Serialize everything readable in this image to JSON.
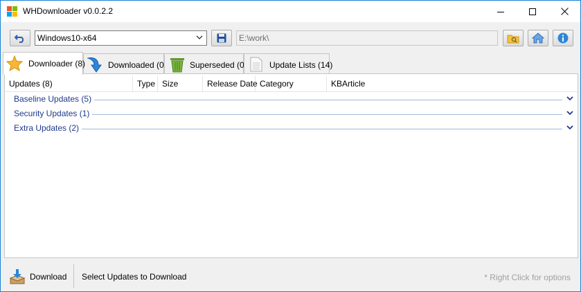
{
  "window": {
    "title": "WHDownloader v0.0.2.2",
    "icon": "windows-logo-icon",
    "controls": {
      "minimize": "minimize-icon",
      "maximize": "maximize-icon",
      "close": "close-icon"
    }
  },
  "toolbar": {
    "refresh_icon": "undo-refresh-icon",
    "os_selected": "Windows10-x64",
    "save_icon": "floppy-disk-icon",
    "path_value": "E:\\work\\",
    "browse_icon": "folder-search-icon",
    "home_icon": "home-icon",
    "info_icon": "info-icon"
  },
  "tabs": [
    {
      "label": "Downloader (8)",
      "icon": "star-icon",
      "active": true
    },
    {
      "label": "Downloaded (0)",
      "icon": "download-arrow-icon",
      "active": false
    },
    {
      "label": "Superseded (0)",
      "icon": "trash-bin-icon",
      "active": false
    },
    {
      "label": "Update Lists (14)",
      "icon": "document-list-icon",
      "active": false
    }
  ],
  "grid": {
    "columns": [
      "Updates (8)",
      "Type",
      "Size",
      "Release Date",
      "Category",
      "KBArticle"
    ],
    "groups": [
      {
        "label": "Baseline Updates (5)"
      },
      {
        "label": "Security Updates (1)"
      },
      {
        "label": "Extra Updates (2)"
      }
    ]
  },
  "statusbar": {
    "download_label": "Download",
    "download_icon": "download-box-icon",
    "status_message": "Select Updates to Download",
    "hint": "* Right Click for options"
  },
  "colors": {
    "accent_border": "#1883d7",
    "group_text": "#1e3a8c",
    "group_line": "#a0bad6"
  }
}
